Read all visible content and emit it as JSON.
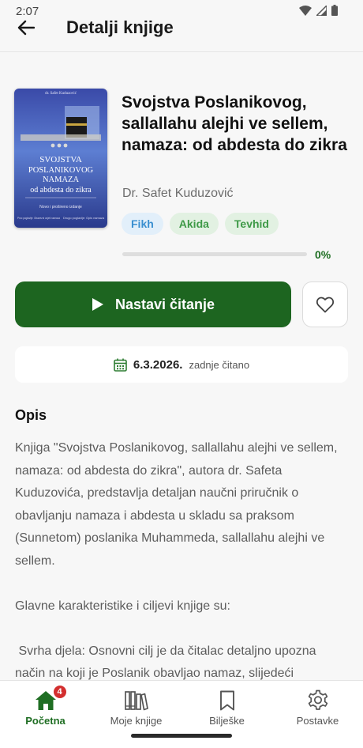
{
  "status": {
    "time": "2:07"
  },
  "header": {
    "title": "Detalji knjige"
  },
  "book": {
    "cover": {
      "top_line": "dr. Safet Kuduzović",
      "title_lines": [
        "SVOJSTVA",
        "POSLANIKOVOG",
        "NAMAZA",
        "od abdesta do zikra"
      ],
      "subtitle": "Novo i prošireno izdanje",
      "bottom_left": "Prvo poglavlje: Obavezni uvjeti namaza",
      "bottom_right": "Drugo poglavlje: Opis namaza"
    },
    "title": "Svojstva Poslanikovog, sallallahu alejhi ve sellem, namaza: od abdesta do zikra",
    "author": "Dr. Safet Kuduzović",
    "tags": [
      "Fikh",
      "Akida",
      "Tevhid"
    ],
    "progress": 0,
    "progress_label": "0%"
  },
  "actions": {
    "continue_label": "Nastavi čitanje"
  },
  "last_read": {
    "date": "6.3.2026.",
    "label": "zadnje čitano"
  },
  "description": {
    "heading": "Opis",
    "paragraphs": [
      "Knjiga \"Svojstva Poslanikovog, sallallahu alejhi ve sellem, namaza: od abdesta do zikra\", autora dr. Safeta Kuduzovića, predstavlja detaljan naučni priručnik o obavljanju namaza i abdesta u skladu sa praksom (Sunnetom) poslanika Muhammeda, sallallahu alejhi ve sellem.",
      "Glavne karakteristike i ciljevi knjige su:",
      " Svrha djela: Osnovni cilj je da čitalac detaljno upozna način na koji je Poslanik obavljao namaz, slijedeći"
    ]
  },
  "nav": {
    "items": [
      {
        "label": "Početna",
        "badge": "4"
      },
      {
        "label": "Moje knjige"
      },
      {
        "label": "Bilješke"
      },
      {
        "label": "Postavke"
      }
    ]
  },
  "colors": {
    "primary": "#1d6520",
    "accent_blue": "#3a8fd0",
    "badge": "#d32f2f"
  }
}
